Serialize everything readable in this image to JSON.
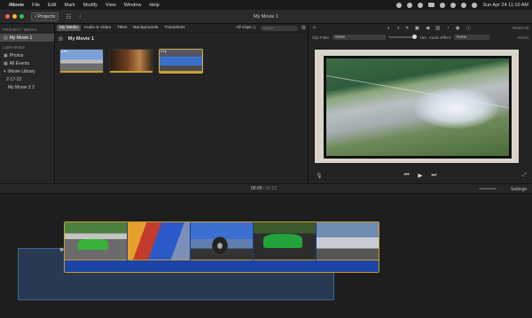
{
  "menubar": {
    "apple_icon": "apple-logo-icon",
    "menus": [
      "iMovie",
      "File",
      "Edit",
      "Mark",
      "Modify",
      "View",
      "Window",
      "Help"
    ],
    "datetime": "Sun Apr 24  11:10 AM"
  },
  "toolbar": {
    "projects_label": "‹ Projects",
    "window_title": "My Movie 1"
  },
  "sidebar": {
    "project_media_heading": "PROJECT MEDIA",
    "project_item": "My Movie 1",
    "libraries_heading": "LIBRARIES",
    "items": [
      {
        "label": "Photos",
        "icon": "photos-icon"
      },
      {
        "label": "All Events",
        "icon": "events-icon"
      },
      {
        "label": "iMovie Library",
        "icon": "chevron-down-icon"
      },
      {
        "label": "2-17-22",
        "icon": ""
      },
      {
        "label": "My Movie 3 2",
        "icon": ""
      }
    ]
  },
  "media": {
    "tabs": [
      "My Media",
      "Audio & Video",
      "Titles",
      "Backgrounds",
      "Transitions"
    ],
    "selected_tab": "My Media",
    "filter_label": "All Clips ◇",
    "search_placeholder": "Search",
    "browser_title": "My Movie 1",
    "clips": [
      {
        "label": "4.5s"
      },
      {
        "label": ""
      },
      {
        "label": "4.1s"
      }
    ]
  },
  "viewer": {
    "reset_all_label": "Reset All",
    "clip_filter_label": "Clip Filter:",
    "clip_filter_value": "None",
    "volume_value": "100",
    "audio_effect_label": "Audio Effect:",
    "audio_effect_value": "None",
    "reset_label": "Reset",
    "tool_icons": [
      "color-balance-icon",
      "color-correction-icon",
      "crop-icon",
      "stabilization-icon",
      "volume-icon",
      "noise-reduction-icon",
      "speed-icon",
      "clip-filter-icon",
      "info-icon"
    ]
  },
  "timeline": {
    "current_time": "00:00",
    "duration": "/ 00:22",
    "settings_label": "Settings"
  },
  "colors": {
    "accent_yellow": "#c89b2e",
    "selection_blue": "#3c6eb4",
    "audio_blue": "#1d45a8"
  }
}
